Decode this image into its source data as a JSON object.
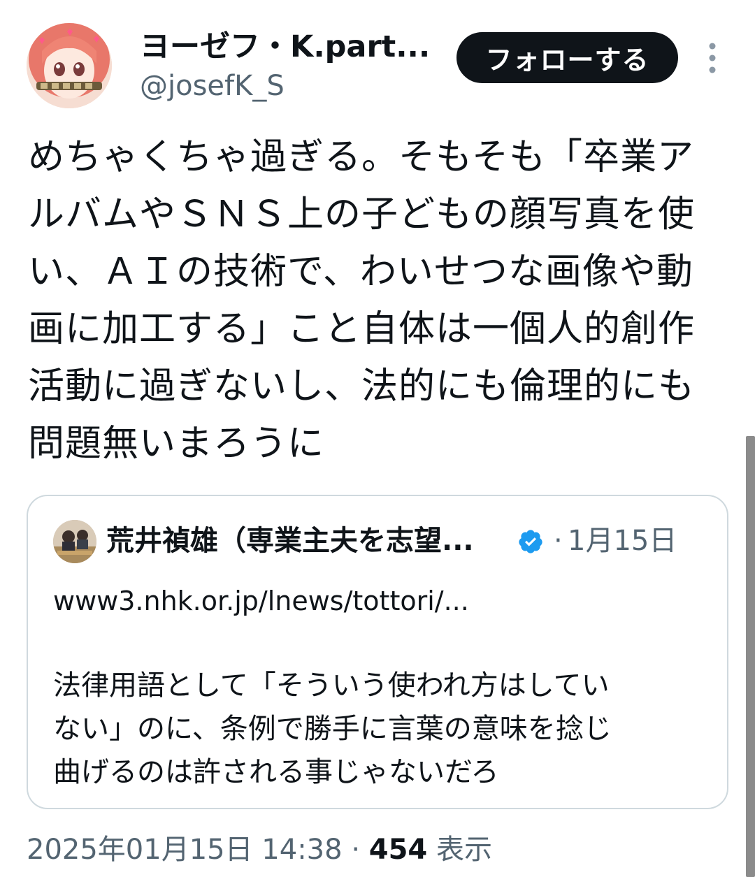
{
  "author": {
    "display_name": "ヨーゼフ・K.part...",
    "handle": "@josefK_S",
    "avatar_icon": "anime-girl-avatar"
  },
  "actions": {
    "follow_label": "フォローする",
    "more_icon": "vertical-ellipsis-icon"
  },
  "tweet": {
    "text": "めちゃくちゃ過ぎる。そもそも「卒業ア\nルバムやＳＮＳ上の子どもの顔写真を使\nい、ＡＩの技術で、わいせつな画像や動\n画に加工する」こと自体は一個人的創作\n活動に過ぎないし、法的にも倫理的にも\n問題無いまろうに"
  },
  "quote": {
    "display_name": "荒井禎雄（専業主夫を志望...",
    "verified_icon": "verified-badge-icon",
    "separator": "·",
    "date": "1月15日",
    "link": "www3.nhk.or.jp/lnews/tottori/...",
    "text": "法律用語として「そういう使われ方はしてい\nない」のに、条例で勝手に言葉の意味を捻じ\n曲げるのは許される事じゃないだろ"
  },
  "meta": {
    "timestamp": "2025年01月15日 14:38",
    "separator": "·",
    "views_count": "454",
    "views_label": "表示"
  },
  "colors": {
    "text_primary": "#0f1419",
    "text_secondary": "#536471",
    "verified_blue": "#1d9bf0",
    "border": "#cfd9de"
  }
}
